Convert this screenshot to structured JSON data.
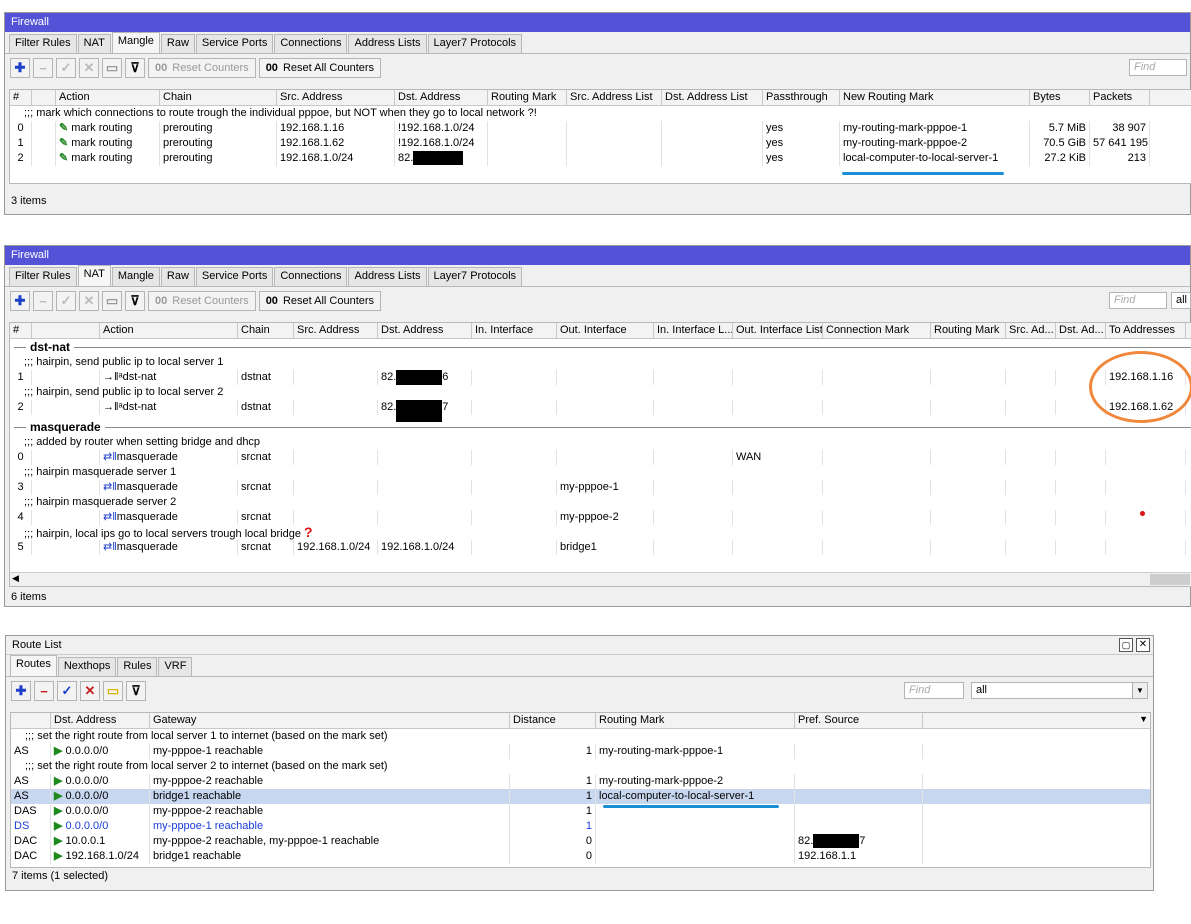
{
  "mangle": {
    "title": "Firewall",
    "tabs": [
      "Filter Rules",
      "NAT",
      "Mangle",
      "Raw",
      "Service Ports",
      "Connections",
      "Address Lists",
      "Layer7 Protocols"
    ],
    "reset_counters": "Reset Counters",
    "reset_all_counters": "Reset All Counters",
    "find_placeholder": "Find",
    "columns": [
      "#",
      "Action",
      "Chain",
      "Src. Address",
      "Dst. Address",
      "Routing Mark",
      "Src. Address List",
      "Dst. Address List",
      "Passthrough",
      "New Routing Mark",
      "Bytes",
      "Packets"
    ],
    "comment": ";;; mark which connections to route trough the individual pppoe, but NOT when they go to local network ?!",
    "rows": [
      {
        "num": "0",
        "action": "mark routing",
        "chain": "prerouting",
        "src": "192.168.1.16",
        "dst": "!192.168.1.0/24",
        "pass": "yes",
        "newmark": "my-routing-mark-pppoe-1",
        "bytes": "5.7 MiB",
        "packets": "38 907"
      },
      {
        "num": "1",
        "action": "mark routing",
        "chain": "prerouting",
        "src": "192.168.1.62",
        "dst": "!192.168.1.0/24",
        "pass": "yes",
        "newmark": "my-routing-mark-pppoe-2",
        "bytes": "70.5 GiB",
        "packets": "57 641 195"
      },
      {
        "num": "2",
        "action": "mark routing",
        "chain": "prerouting",
        "src": "192.168.1.0/24",
        "dst": "82.",
        "pass": "yes",
        "newmark": "local-computer-to-local-server-1",
        "bytes": "27.2 KiB",
        "packets": "213"
      }
    ],
    "status": "3 items",
    "accent_color": "#1a8fd6"
  },
  "nat": {
    "title": "Firewall",
    "tabs": [
      "Filter Rules",
      "NAT",
      "Mangle",
      "Raw",
      "Service Ports",
      "Connections",
      "Address Lists",
      "Layer7 Protocols"
    ],
    "reset_counters": "Reset Counters",
    "reset_all_counters": "Reset All Counters",
    "find_placeholder": "Find",
    "filter_value": "all",
    "columns": [
      "#",
      "Action",
      "Chain",
      "Src. Address",
      "Dst. Address",
      "In. Interface",
      "Out. Interface",
      "In. Interface L...",
      "Out. Interface List",
      "Connection Mark",
      "Routing Mark",
      "Src. Ad...",
      "Dst. Ad...",
      "To Addresses"
    ],
    "group1": "dst-nat",
    "c1": ";;; hairpin, send public ip to local server 1",
    "r1": {
      "num": "1",
      "action": "dst-nat",
      "chain": "dstnat",
      "dst_pre": "82.",
      "dst_suf": "6",
      "to": "192.168.1.16"
    },
    "c2": ";;; hairpin, send public ip to local server 2",
    "r2": {
      "num": "2",
      "action": "dst-nat",
      "chain": "dstnat",
      "dst_pre": "82.",
      "dst_suf": "7",
      "to": "192.168.1.62"
    },
    "group2": "masquerade",
    "c3": ";;; added by router when setting bridge and dhcp",
    "r3": {
      "num": "0",
      "action": "masquerade",
      "chain": "srcnat",
      "outlist": "WAN"
    },
    "c4": ";;; hairpin masquerade server 1",
    "r4": {
      "num": "3",
      "action": "masquerade",
      "chain": "srcnat",
      "out": "my-pppoe-1"
    },
    "c5": ";;; hairpin masquerade server 2",
    "r5": {
      "num": "4",
      "action": "masquerade",
      "chain": "srcnat",
      "out": "my-pppoe-2"
    },
    "c6": ";;; hairpin, local ips go to local servers trough local bridge",
    "qmark": "?",
    "r6": {
      "num": "5",
      "action": "masquerade",
      "chain": "srcnat",
      "src": "192.168.1.0/24",
      "dst": "192.168.1.0/24",
      "out": "bridge1"
    },
    "status": "6 items",
    "highlight_color": "#f0873a"
  },
  "routes": {
    "title": "Route List",
    "tabs": [
      "Routes",
      "Nexthops",
      "Rules",
      "VRF"
    ],
    "find_placeholder": "Find",
    "filter_value": "all",
    "columns": [
      "",
      "Dst. Address",
      "Gateway",
      "Distance",
      "Routing Mark",
      "Pref. Source"
    ],
    "c1": ";;; set the right route from local server 1 to internet (based on the mark set)",
    "r1": {
      "flags": "AS",
      "dst": "0.0.0.0/0",
      "gw": "my-pppoe-1 reachable",
      "dist": "1",
      "mark": "my-routing-mark-pppoe-1"
    },
    "c2": ";;; set the right route from local server 2 to internet (based on the mark set)",
    "r2": {
      "flags": "AS",
      "dst": "0.0.0.0/0",
      "gw": "my-pppoe-2 reachable",
      "dist": "1",
      "mark": "my-routing-mark-pppoe-2"
    },
    "r3": {
      "flags": "AS",
      "dst": "0.0.0.0/0",
      "gw": "bridge1 reachable",
      "dist": "1",
      "mark": "local-computer-to-local-server-1"
    },
    "r4": {
      "flags": "DAS",
      "dst": "0.0.0.0/0",
      "gw": "my-pppoe-2 reachable",
      "dist": "1"
    },
    "r5": {
      "flags": "DS",
      "dst": "0.0.0.0/0",
      "gw": "my-pppoe-1 reachable",
      "dist": "1"
    },
    "r6": {
      "flags": "DAC",
      "dst": "10.0.0.1",
      "gw": "my-pppoe-2 reachable, my-pppoe-1 reachable",
      "dist": "0",
      "pref_pre": "82.",
      "pref_suf": "7"
    },
    "r7": {
      "flags": "DAC",
      "dst": "192.168.1.0/24",
      "gw": "bridge1 reachable",
      "dist": "0",
      "pref": "192.168.1.1"
    },
    "status": "7 items (1 selected)"
  }
}
